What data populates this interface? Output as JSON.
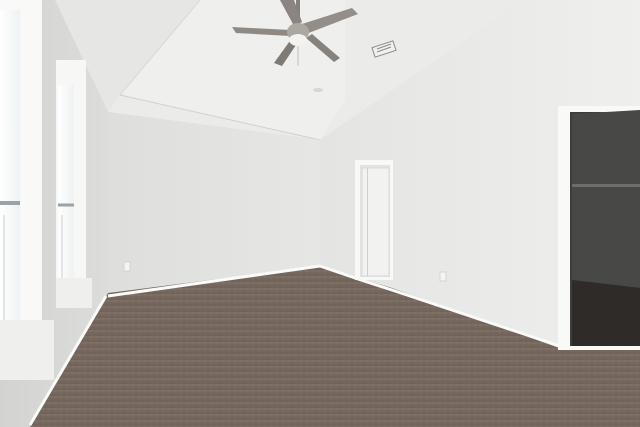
{
  "scene": {
    "subject": "empty bedroom",
    "colors": {
      "wall_light": "#e9e9e7",
      "wall_shadow": "#d6d6d3",
      "ceiling": "#ececea",
      "carpet": "#7a6c61",
      "trim": "#f7f7f6",
      "closet_dark": "#3c3c3a",
      "fan_metal": "#8c8780"
    }
  }
}
